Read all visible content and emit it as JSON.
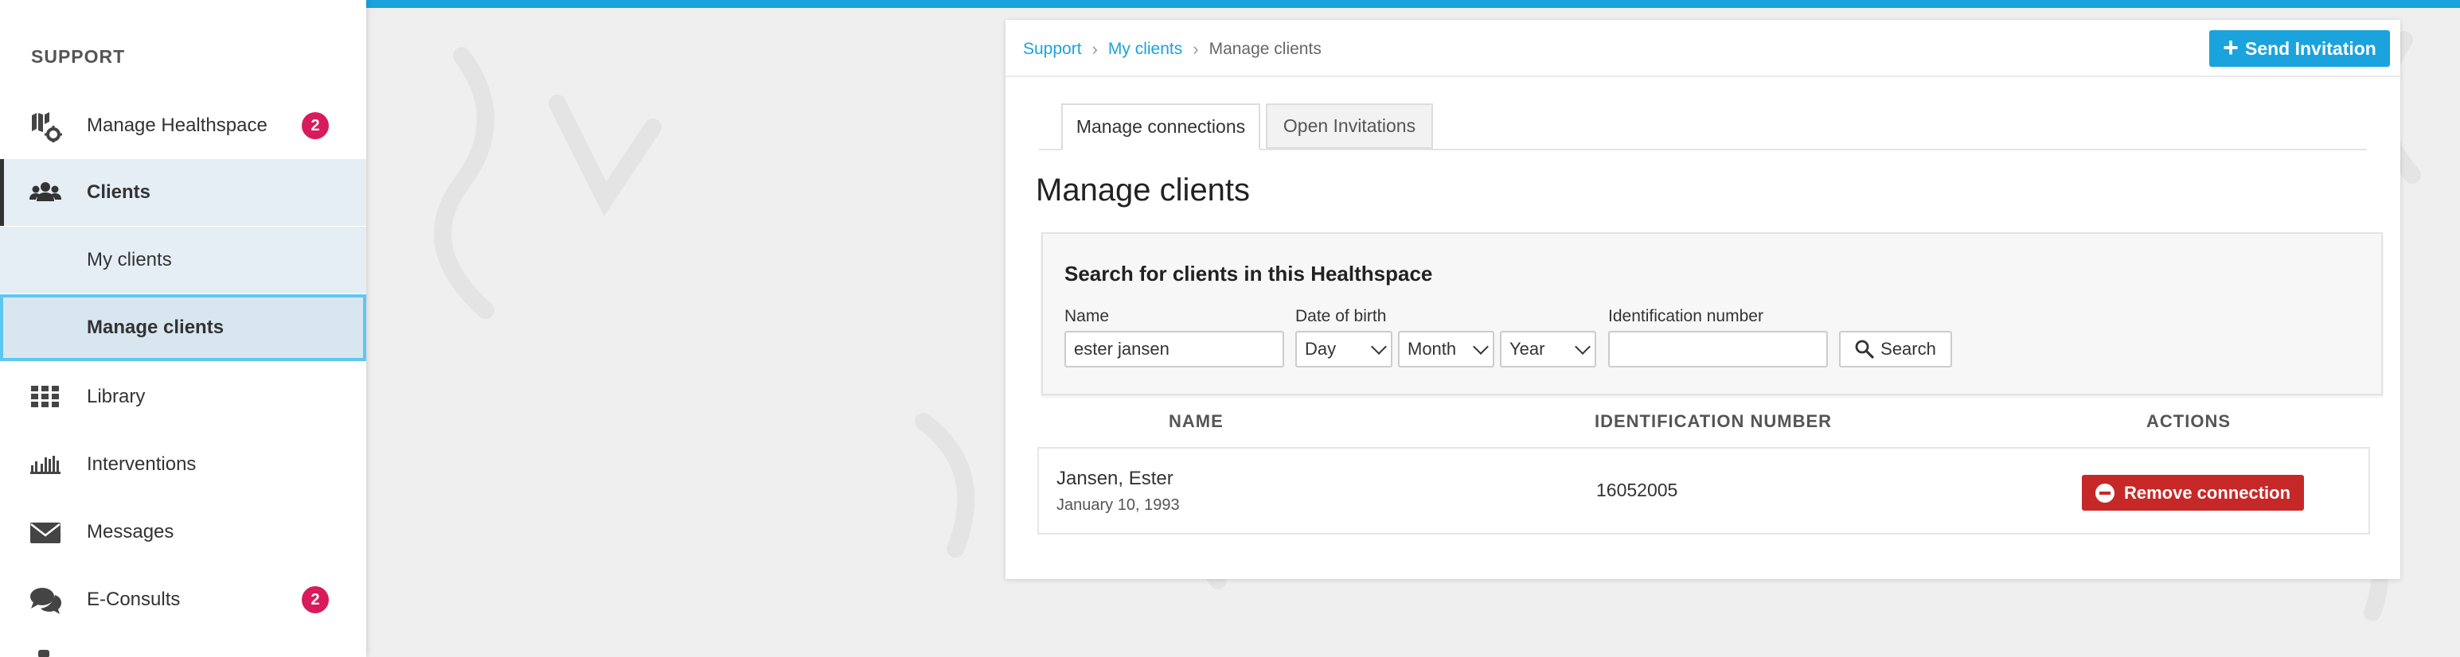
{
  "sidebar": {
    "section": "SUPPORT",
    "items": [
      {
        "label": "Manage Healthspace",
        "icon": "healthspace-settings-icon",
        "badge": "2"
      },
      {
        "label": "Clients",
        "icon": "users-icon"
      },
      {
        "label": "My clients"
      },
      {
        "label": "Manage clients"
      },
      {
        "label": "Library",
        "icon": "grid-icon"
      },
      {
        "label": "Interventions",
        "icon": "bookshelf-icon"
      },
      {
        "label": "Messages",
        "icon": "envelope-icon"
      },
      {
        "label": "E-Consults",
        "icon": "chat-icon",
        "badge": "2"
      }
    ]
  },
  "breadcrumb": [
    "Support",
    "My clients",
    "Manage clients"
  ],
  "send_invitation": "Send Invitation",
  "tabs": [
    "Manage connections",
    "Open Invitations"
  ],
  "page_title": "Manage clients",
  "search": {
    "title": "Search for clients in this Healthspace",
    "name_label": "Name",
    "name_value": "ester jansen",
    "dob_label": "Date of birth",
    "day": "Day",
    "month": "Month",
    "year": "Year",
    "id_label": "Identification number",
    "id_value": "",
    "button": "Search"
  },
  "table": {
    "headers": [
      "NAME",
      "IDENTIFICATION NUMBER",
      "ACTIONS"
    ],
    "rows": [
      {
        "name": "Jansen, Ester",
        "dob": "January 10, 1993",
        "id": "16052005",
        "action": "Remove connection"
      }
    ]
  },
  "colors": {
    "accent": "#1aa3dc",
    "danger": "#c62828",
    "badge": "#d81b5a"
  }
}
